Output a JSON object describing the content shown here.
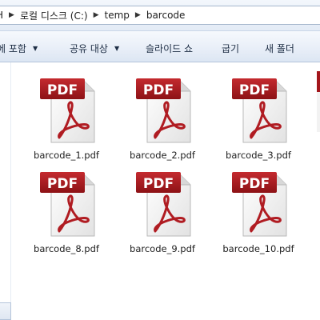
{
  "address_bar": {
    "crumb_partial": "H",
    "crumbs": [
      "로컬 디스크 (C:)",
      "temp",
      "barcode"
    ]
  },
  "toolbar": {
    "include_in_library": "에 포함",
    "share_with": "공유 대상",
    "slideshow": "슬라이드 쇼",
    "burn": "굽기",
    "new_folder": "새 폴더"
  },
  "files": [
    {
      "name": "barcode_1.pdf",
      "icon": "pdf-file-icon",
      "label": "PDF"
    },
    {
      "name": "barcode_2.pdf",
      "icon": "pdf-file-icon",
      "label": "PDF"
    },
    {
      "name": "barcode_3.pdf",
      "icon": "pdf-file-icon",
      "label": "PDF"
    },
    {
      "name": "barcode_8.pdf",
      "icon": "pdf-file-icon",
      "label": "PDF"
    },
    {
      "name": "barcode_9.pdf",
      "icon": "pdf-file-icon",
      "label": "PDF"
    },
    {
      "name": "barcode_10.pdf",
      "icon": "pdf-file-icon",
      "label": "PDF"
    }
  ],
  "colors": {
    "pdf_banner": "#a3161b",
    "pdf_logo": "#b01c22",
    "toolbar_text": "#1e2e45"
  }
}
